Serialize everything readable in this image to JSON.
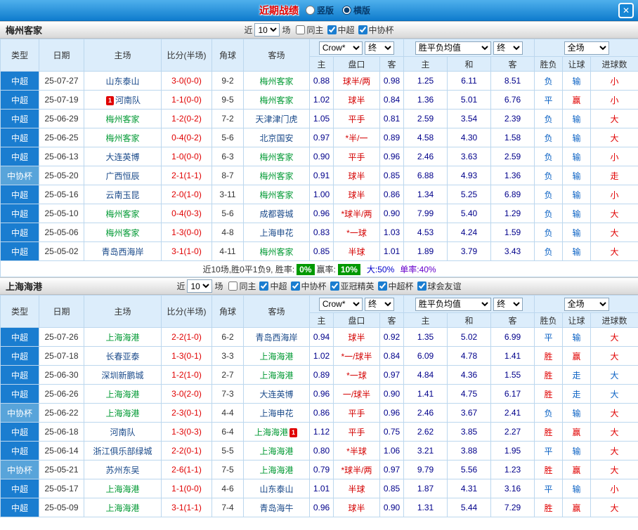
{
  "topbar": {
    "title": "近期战绩",
    "radio_vertical": "竖版",
    "radio_horizontal": "横版",
    "selected": "横版",
    "close": "✕"
  },
  "columns": {
    "type": "类型",
    "date": "日期",
    "home": "主场",
    "score": "比分(半场)",
    "corner": "角球",
    "away": "客场",
    "asia_home": "主",
    "asia_pan": "盘口",
    "asia_away": "客",
    "eu_home": "主",
    "eu_draw": "和",
    "eu_away": "客",
    "result": "胜负",
    "handicap": "让球",
    "goals": "进球数",
    "company_select": "Crow*",
    "final_select": "终",
    "eu_select": "胜平负均值",
    "scope_select": "全场"
  },
  "sections": [
    {
      "team": "梅州客家",
      "filters": {
        "near": "近",
        "count": "10",
        "unit": "场",
        "options": [
          {
            "label": "同主",
            "checked": false
          },
          {
            "label": "中超",
            "checked": true
          },
          {
            "label": "中协杯",
            "checked": true
          }
        ]
      },
      "rows": [
        {
          "type": "中超",
          "cup": false,
          "date": "25-07-27",
          "home": "山东泰山",
          "home_color": "dark",
          "score": "3-0(0-0)",
          "corner": "9-2",
          "away": "梅州客家",
          "away_color": "green",
          "o1": "0.88",
          "pan": "球半/两",
          "o2": "0.98",
          "e1": "1.25",
          "e2": "6.11",
          "e3": "8.51",
          "res": "负",
          "res_c": "blue",
          "han": "输",
          "han_c": "blue",
          "goal": "小",
          "goal_c": "red"
        },
        {
          "type": "中超",
          "cup": false,
          "date": "25-07-19",
          "home": "河南队",
          "home_color": "dark",
          "home_badge": "1",
          "score": "1-1(0-0)",
          "corner": "9-5",
          "away": "梅州客家",
          "away_color": "green",
          "o1": "1.02",
          "pan": "球半",
          "o2": "0.84",
          "e1": "1.36",
          "e2": "5.01",
          "e3": "6.76",
          "res": "平",
          "res_c": "blue",
          "han": "赢",
          "han_c": "red",
          "goal": "小",
          "goal_c": "red"
        },
        {
          "type": "中超",
          "cup": false,
          "date": "25-06-29",
          "home": "梅州客家",
          "home_color": "green",
          "score": "1-2(0-2)",
          "corner": "7-2",
          "away": "天津津门虎",
          "away_color": "dark",
          "o1": "1.05",
          "pan": "平手",
          "o2": "0.81",
          "e1": "2.59",
          "e2": "3.54",
          "e3": "2.39",
          "res": "负",
          "res_c": "blue",
          "han": "输",
          "han_c": "blue",
          "goal": "大",
          "goal_c": "red"
        },
        {
          "type": "中超",
          "cup": false,
          "date": "25-06-25",
          "home": "梅州客家",
          "home_color": "green",
          "score": "0-4(0-2)",
          "corner": "5-6",
          "away": "北京国安",
          "away_color": "dark",
          "o1": "0.97",
          "pan": "*半/一",
          "o2": "0.89",
          "e1": "4.58",
          "e2": "4.30",
          "e3": "1.58",
          "res": "负",
          "res_c": "blue",
          "han": "输",
          "han_c": "blue",
          "goal": "大",
          "goal_c": "red"
        },
        {
          "type": "中超",
          "cup": false,
          "date": "25-06-13",
          "home": "大连英博",
          "home_color": "dark",
          "score": "1-0(0-0)",
          "corner": "6-3",
          "away": "梅州客家",
          "away_color": "green",
          "o1": "0.90",
          "pan": "平手",
          "o2": "0.96",
          "e1": "2.46",
          "e2": "3.63",
          "e3": "2.59",
          "res": "负",
          "res_c": "blue",
          "han": "输",
          "han_c": "blue",
          "goal": "小",
          "goal_c": "red"
        },
        {
          "type": "中协杯",
          "cup": true,
          "date": "25-05-20",
          "home": "广西恒辰",
          "home_color": "dark",
          "score": "2-1(1-1)",
          "corner": "8-7",
          "away": "梅州客家",
          "away_color": "green",
          "o1": "0.91",
          "pan": "球半",
          "o2": "0.85",
          "e1": "6.88",
          "e2": "4.93",
          "e3": "1.36",
          "res": "负",
          "res_c": "blue",
          "han": "输",
          "han_c": "blue",
          "goal": "走",
          "goal_c": "red"
        },
        {
          "type": "中超",
          "cup": false,
          "date": "25-05-16",
          "home": "云南玉昆",
          "home_color": "dark",
          "score": "2-0(1-0)",
          "corner": "3-11",
          "away": "梅州客家",
          "away_color": "green",
          "o1": "1.00",
          "pan": "球半",
          "o2": "0.86",
          "e1": "1.34",
          "e2": "5.25",
          "e3": "6.89",
          "res": "负",
          "res_c": "blue",
          "han": "输",
          "han_c": "blue",
          "goal": "小",
          "goal_c": "red"
        },
        {
          "type": "中超",
          "cup": false,
          "date": "25-05-10",
          "home": "梅州客家",
          "home_color": "green",
          "score": "0-4(0-3)",
          "corner": "5-6",
          "away": "成都蓉城",
          "away_color": "dark",
          "o1": "0.96",
          "pan": "*球半/两",
          "o2": "0.90",
          "e1": "7.99",
          "e2": "5.40",
          "e3": "1.29",
          "res": "负",
          "res_c": "blue",
          "han": "输",
          "han_c": "blue",
          "goal": "大",
          "goal_c": "red"
        },
        {
          "type": "中超",
          "cup": false,
          "date": "25-05-06",
          "home": "梅州客家",
          "home_color": "green",
          "score": "1-3(0-0)",
          "corner": "4-8",
          "away": "上海申花",
          "away_color": "dark",
          "o1": "0.83",
          "pan": "*一球",
          "o2": "1.03",
          "e1": "4.53",
          "e2": "4.24",
          "e3": "1.59",
          "res": "负",
          "res_c": "blue",
          "han": "输",
          "han_c": "blue",
          "goal": "大",
          "goal_c": "red"
        },
        {
          "type": "中超",
          "cup": false,
          "date": "25-05-02",
          "home": "青岛西海岸",
          "home_color": "dark",
          "score": "3-1(1-0)",
          "corner": "4-11",
          "away": "梅州客家",
          "away_color": "green",
          "o1": "0.85",
          "pan": "半球",
          "o2": "1.01",
          "e1": "1.89",
          "e2": "3.79",
          "e3": "3.43",
          "res": "负",
          "res_c": "blue",
          "han": "输",
          "han_c": "blue",
          "goal": "大",
          "goal_c": "red"
        }
      ],
      "summary": {
        "prefix": "近10场,胜0平1负9, 胜率:",
        "rate1": "0%",
        "mid": "赢率:",
        "rate2": "10%",
        "big": "大:50%",
        "single": "单率:40%"
      }
    },
    {
      "team": "上海海港",
      "filters": {
        "near": "近",
        "count": "10",
        "unit": "场",
        "options": [
          {
            "label": "同主",
            "checked": false
          },
          {
            "label": "中超",
            "checked": true
          },
          {
            "label": "中协杯",
            "checked": true
          },
          {
            "label": "亚冠精英",
            "checked": true
          },
          {
            "label": "中超杯",
            "checked": true
          },
          {
            "label": "球会友谊",
            "checked": true
          }
        ]
      },
      "rows": [
        {
          "type": "中超",
          "cup": false,
          "date": "25-07-26",
          "home": "上海海港",
          "home_color": "green",
          "score": "2-2(1-0)",
          "corner": "6-2",
          "away": "青岛西海岸",
          "away_color": "dark",
          "o1": "0.94",
          "pan": "球半",
          "o2": "0.92",
          "e1": "1.35",
          "e2": "5.02",
          "e3": "6.99",
          "res": "平",
          "res_c": "blue",
          "han": "输",
          "han_c": "blue",
          "goal": "大",
          "goal_c": "red"
        },
        {
          "type": "中超",
          "cup": false,
          "date": "25-07-18",
          "home": "长春亚泰",
          "home_color": "dark",
          "score": "1-3(0-1)",
          "corner": "3-3",
          "away": "上海海港",
          "away_color": "green",
          "o1": "1.02",
          "pan": "*一/球半",
          "o2": "0.84",
          "e1": "6.09",
          "e2": "4.78",
          "e3": "1.41",
          "res": "胜",
          "res_c": "red",
          "han": "赢",
          "han_c": "red",
          "goal": "大",
          "goal_c": "red"
        },
        {
          "type": "中超",
          "cup": false,
          "date": "25-06-30",
          "home": "深圳新鹏城",
          "home_color": "dark",
          "score": "1-2(1-0)",
          "corner": "2-7",
          "away": "上海海港",
          "away_color": "green",
          "o1": "0.89",
          "pan": "*一球",
          "o2": "0.97",
          "e1": "4.84",
          "e2": "4.36",
          "e3": "1.55",
          "res": "胜",
          "res_c": "red",
          "han": "走",
          "han_c": "blue",
          "goal": "大",
          "goal_c": "blue"
        },
        {
          "type": "中超",
          "cup": false,
          "date": "25-06-26",
          "home": "上海海港",
          "home_color": "green",
          "score": "3-0(2-0)",
          "corner": "7-3",
          "away": "大连英博",
          "away_color": "dark",
          "o1": "0.96",
          "pan": "一/球半",
          "o2": "0.90",
          "e1": "1.41",
          "e2": "4.75",
          "e3": "6.17",
          "res": "胜",
          "res_c": "red",
          "han": "走",
          "han_c": "blue",
          "goal": "大",
          "goal_c": "blue"
        },
        {
          "type": "中协杯",
          "cup": true,
          "date": "25-06-22",
          "home": "上海海港",
          "home_color": "green",
          "score": "2-3(0-1)",
          "corner": "4-4",
          "away": "上海申花",
          "away_color": "dark",
          "o1": "0.86",
          "pan": "平手",
          "o2": "0.96",
          "e1": "2.46",
          "e2": "3.67",
          "e3": "2.41",
          "res": "负",
          "res_c": "blue",
          "han": "输",
          "han_c": "blue",
          "goal": "大",
          "goal_c": "red"
        },
        {
          "type": "中超",
          "cup": false,
          "date": "25-06-18",
          "home": "河南队",
          "home_color": "dark",
          "score": "1-3(0-3)",
          "corner": "6-4",
          "away": "上海海港",
          "away_color": "green",
          "away_badge": "1",
          "o1": "1.12",
          "pan": "平手",
          "o2": "0.75",
          "e1": "2.62",
          "e2": "3.85",
          "e3": "2.27",
          "res": "胜",
          "res_c": "red",
          "han": "赢",
          "han_c": "red",
          "goal": "大",
          "goal_c": "red"
        },
        {
          "type": "中超",
          "cup": false,
          "date": "25-06-14",
          "home": "浙江俱乐部绿城",
          "home_color": "dark",
          "score": "2-2(0-1)",
          "corner": "5-5",
          "away": "上海海港",
          "away_color": "green",
          "o1": "0.80",
          "pan": "*半球",
          "o2": "1.06",
          "e1": "3.21",
          "e2": "3.88",
          "e3": "1.95",
          "res": "平",
          "res_c": "blue",
          "han": "输",
          "han_c": "blue",
          "goal": "大",
          "goal_c": "red"
        },
        {
          "type": "中协杯",
          "cup": true,
          "date": "25-05-21",
          "home": "苏州东吴",
          "home_color": "dark",
          "score": "2-6(1-1)",
          "corner": "7-5",
          "away": "上海海港",
          "away_color": "green",
          "o1": "0.79",
          "pan": "*球半/两",
          "o2": "0.97",
          "e1": "9.79",
          "e2": "5.56",
          "e3": "1.23",
          "res": "胜",
          "res_c": "red",
          "han": "赢",
          "han_c": "red",
          "goal": "大",
          "goal_c": "red"
        },
        {
          "type": "中超",
          "cup": false,
          "date": "25-05-17",
          "home": "上海海港",
          "home_color": "green",
          "score": "1-1(0-0)",
          "corner": "4-6",
          "away": "山东泰山",
          "away_color": "dark",
          "o1": "1.01",
          "pan": "半球",
          "o2": "0.85",
          "e1": "1.87",
          "e2": "4.31",
          "e3": "3.16",
          "res": "平",
          "res_c": "blue",
          "han": "输",
          "han_c": "blue",
          "goal": "小",
          "goal_c": "red"
        },
        {
          "type": "中超",
          "cup": false,
          "date": "25-05-09",
          "home": "上海海港",
          "home_color": "green",
          "score": "3-1(1-1)",
          "corner": "7-4",
          "away": "青岛海牛",
          "away_color": "dark",
          "o1": "0.96",
          "pan": "球半",
          "o2": "0.90",
          "e1": "1.31",
          "e2": "5.44",
          "e3": "7.29",
          "res": "胜",
          "res_c": "red",
          "han": "赢",
          "han_c": "red",
          "goal": "大",
          "goal_c": "red"
        }
      ],
      "summary": null
    }
  ]
}
